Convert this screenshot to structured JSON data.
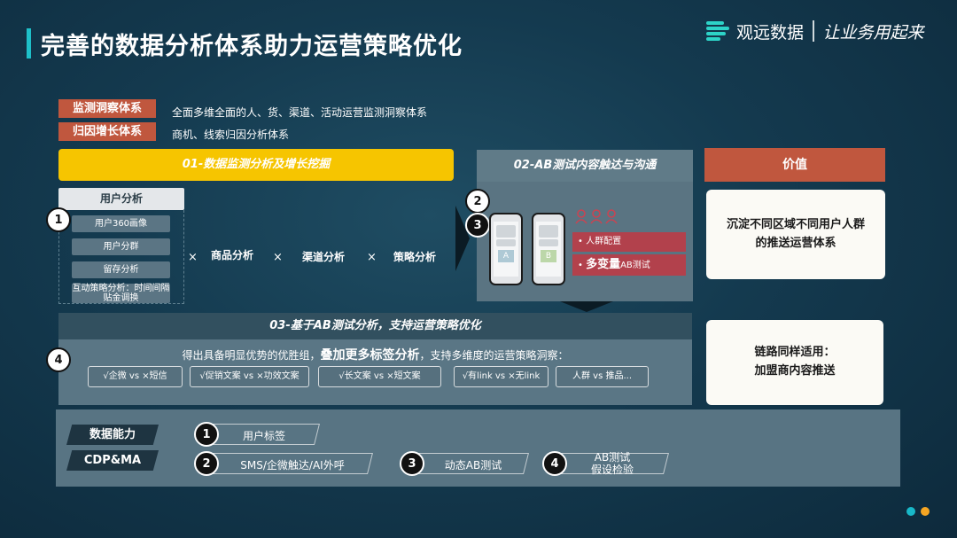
{
  "header": {
    "title": "完善的数据分析体系助力运营策略优化",
    "logo_name": "观远数据",
    "slogan": "让业务用起来"
  },
  "system_tags": [
    {
      "tag": "监测洞察体系",
      "desc": "全面多维全面的人、货、渠道、活动运营监测洞察体系"
    },
    {
      "tag": "归因增长体系",
      "desc": "商机、线索归因分析体系"
    }
  ],
  "section1": {
    "title": "01-数据监测分析及增长挖掘",
    "user_analysis": "用户分析",
    "sub_items": [
      "用户360画像",
      "用户分群",
      "留存分析",
      "互动策略分析：时间间隔贴金调换"
    ],
    "times_symbol": "×",
    "analyses": [
      "商品分析",
      "渠道分析",
      "策略分析"
    ]
  },
  "section2": {
    "title": "02-AB测试内容触达与沟通",
    "phone_a": "A",
    "phone_b": "B",
    "bullet1": "人群配置",
    "bullet2_bold": "多变量",
    "bullet2_rest": "AB测试"
  },
  "value": {
    "title": "价值",
    "card1": [
      "沉淀不同区域不同用户人群",
      "的推送运营体系"
    ],
    "card2": [
      "链路同样适用：",
      "加盟商内容推送"
    ]
  },
  "section3": {
    "title": "03-基于AB测试分析，支持运营策略优化",
    "desc_before": "得出具备明显优势的优胜组，",
    "desc_bold": "叠加更多标签分析",
    "desc_after": "，支持多维度的运营策略洞察：",
    "pills": [
      "√企微 vs ×短信",
      "√促销文案 vs ×功效文案",
      "√长文案 vs ×短文案",
      "√有link vs ×无link",
      "人群 vs 推品..."
    ]
  },
  "bottom": {
    "tags": [
      "数据能力",
      "CDP&MA"
    ],
    "items": [
      {
        "num": "1",
        "label": "用户标签"
      },
      {
        "num": "2",
        "label": "SMS/企微触达/AI外呼"
      },
      {
        "num": "3",
        "label": "动态AB测试"
      },
      {
        "num": "4",
        "label_lines": [
          "AB测试",
          "假设检验"
        ]
      }
    ]
  },
  "markers": {
    "m1": "1",
    "m2": "2",
    "m3": "3",
    "m4": "4"
  },
  "colors": {
    "accent_teal": "#1ec0c9",
    "yellow": "#f6c500",
    "red": "#c0573e",
    "dot_teal": "#18b8c8",
    "dot_orange": "#f5a623"
  }
}
